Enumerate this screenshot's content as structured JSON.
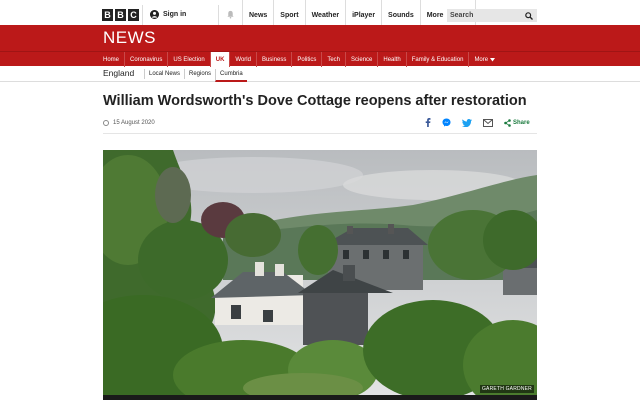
{
  "topbar": {
    "logo_letters": [
      "B",
      "B",
      "C"
    ],
    "sign_in": "Sign in",
    "nav": [
      "News",
      "Sport",
      "Weather",
      "iPlayer",
      "Sounds"
    ],
    "more": "More",
    "search_placeholder": "Search"
  },
  "header": {
    "logo": "NEWS"
  },
  "mainnav": {
    "items": [
      "Home",
      "Coronavirus",
      "US Election",
      "UK",
      "World",
      "Business",
      "Politics",
      "Tech",
      "Science",
      "Health",
      "Family & Education"
    ],
    "active": "UK",
    "more": "More"
  },
  "subnav": {
    "region": "England",
    "links": [
      "Local News",
      "Regions",
      "Cumbria"
    ],
    "current": "Cumbria"
  },
  "article": {
    "headline": "William Wordsworth's Dove Cottage reopens after restoration",
    "date": "15 August 2020",
    "share_label": "Share",
    "image_credit": "GARETH GARDNER"
  },
  "colors": {
    "brand_red": "#bb1919",
    "share_green": "#1a7a3e"
  }
}
